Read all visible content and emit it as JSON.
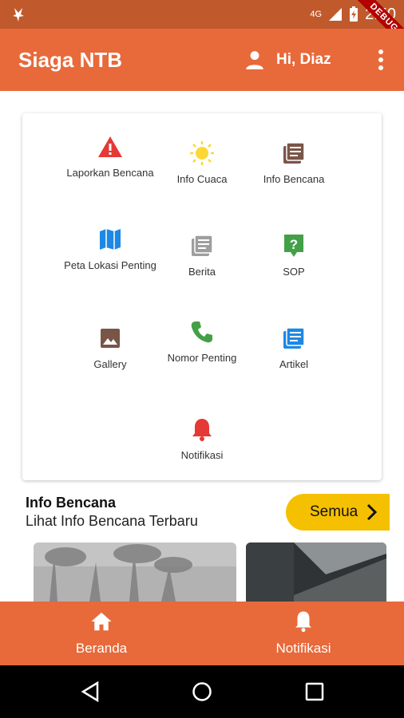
{
  "status_bar": {
    "network": "4G",
    "time": "2:50",
    "debug_label": "DEBUG"
  },
  "app_bar": {
    "title": "Siaga NTB",
    "greeting": "Hi, Diaz"
  },
  "menu": [
    {
      "label": "Laporkan Bencana",
      "icon": "warning-icon",
      "color": "#e53935"
    },
    {
      "label": "Info Cuaca",
      "icon": "sun-icon",
      "color": "#fdd835"
    },
    {
      "label": "Info Bencana",
      "icon": "news-icon",
      "color": "#795548"
    },
    {
      "label": "Peta Lokasi Penting",
      "icon": "map-icon",
      "color": "#1e88e5"
    },
    {
      "label": "Berita",
      "icon": "library-books-icon",
      "color": "#9e9e9e"
    },
    {
      "label": "SOP",
      "icon": "help-icon",
      "color": "#43a047"
    },
    {
      "label": "Gallery",
      "icon": "image-icon",
      "color": "#795548"
    },
    {
      "label": "Nomor Penting",
      "icon": "phone-icon",
      "color": "#43a047"
    },
    {
      "label": "Artikel",
      "icon": "article-icon",
      "color": "#1e88e5"
    },
    {
      "label": "Notifikasi",
      "icon": "bell-icon",
      "color": "#e53935"
    }
  ],
  "info_section": {
    "title": "Info Bencana",
    "subtitle": "Lihat Info Bencana Terbaru",
    "button_label": "Semua"
  },
  "bottom_nav": [
    {
      "label": "Beranda",
      "icon": "home-icon"
    },
    {
      "label": "Notifikasi",
      "icon": "bell-icon"
    }
  ],
  "colors": {
    "status_bar": "#c05a2c",
    "primary": "#e8693a",
    "accent_button": "#f5c000"
  }
}
